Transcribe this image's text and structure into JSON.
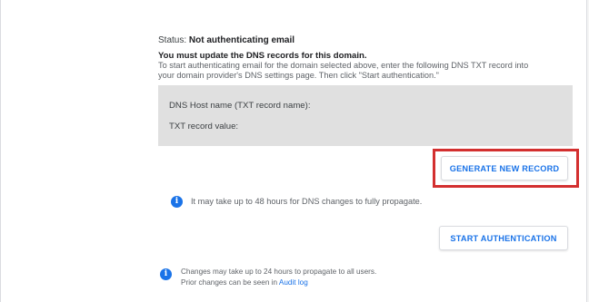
{
  "status": {
    "label": "Status:",
    "value": "Not authenticating email"
  },
  "warning": {
    "title": "You must update the DNS records for this domain.",
    "instruction_line1": "To start authenticating email for the domain selected above, enter the following DNS TXT record into",
    "instruction_line2": "your domain provider's DNS settings page. Then click \"Start authentication.\""
  },
  "dns_record": {
    "host_label": "DNS Host name (TXT record name):",
    "value_label": "TXT record value:"
  },
  "buttons": {
    "generate": "GENERATE NEW RECORD",
    "start_auth": "START AUTHENTICATION"
  },
  "notices": {
    "propagation": "It may take up to 48 hours for DNS changes to fully propagate.",
    "footer_line1": "Changes may take up to 24 hours to propagate to all users.",
    "footer_line2_prefix": "Prior changes can be seen in",
    "audit_link": "Audit log"
  },
  "icons": {
    "info": "info-icon",
    "info_glyph": "i"
  },
  "colors": {
    "accent": "#1a73e8",
    "highlight": "#d32f2f",
    "record_box": "#e0e0e0"
  }
}
